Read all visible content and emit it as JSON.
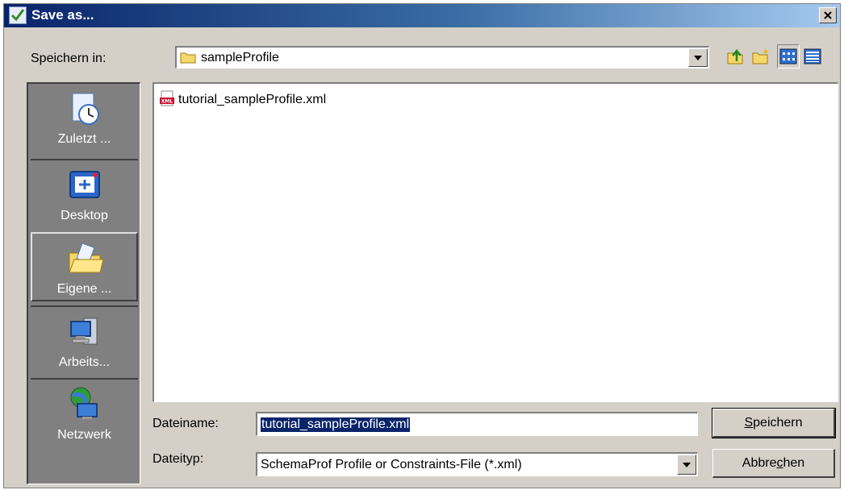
{
  "window": {
    "title": "Save as..."
  },
  "lookin": {
    "label": "Speichern in:",
    "value": "sampleProfile"
  },
  "toolbar": {
    "items": [
      {
        "name": "up-one-level-icon"
      },
      {
        "name": "new-folder-icon"
      },
      {
        "name": "list-view-icon",
        "pressed": true
      },
      {
        "name": "details-view-icon"
      }
    ]
  },
  "places": [
    {
      "label": "Zuletzt ...",
      "icon": "recent-items-icon"
    },
    {
      "label": "Desktop",
      "icon": "desktop-icon"
    },
    {
      "label": "Eigene ...",
      "icon": "my-documents-icon",
      "active": true
    },
    {
      "label": "Arbeits...",
      "icon": "my-computer-icon"
    },
    {
      "label": "Netzwerk",
      "icon": "network-icon"
    }
  ],
  "files": [
    {
      "name": "tutorial_sampleProfile.xml",
      "icon": "xml-file-icon"
    }
  ],
  "filename": {
    "label": "Dateiname:",
    "value": "tutorial_sampleProfile.xml"
  },
  "filetype": {
    "label": "Dateityp:",
    "value": "SchemaProf Profile or Constraints-File (*.xml)"
  },
  "buttons": {
    "save_pre": "S",
    "save_rest": "peichern",
    "cancel_pre": "Abbre",
    "cancel_u": "c",
    "cancel_rest": "hen"
  },
  "colors": {
    "titlebar_start": "#0a246a",
    "titlebar_end": "#a6caf0",
    "face": "#d4d0c8",
    "places_bg": "#808080"
  }
}
